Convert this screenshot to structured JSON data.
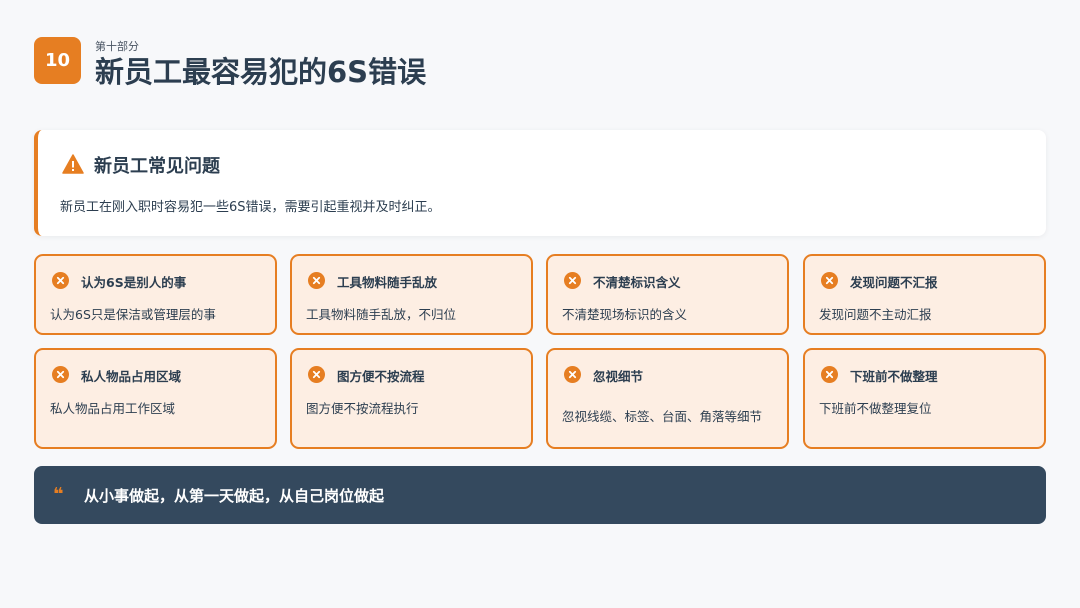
{
  "header": {
    "section_number": "10",
    "section_kicker": "第十部分",
    "title": "新员工最容易犯的6S错误"
  },
  "intro": {
    "icon": "warning-triangle-icon",
    "title": "新员工常见问题",
    "text": "新员工在刚入职时容易犯一些6S错误，需要引起重视并及时纠正。"
  },
  "mistakes": [
    {
      "title": "认为6S是别人的事",
      "desc": "认为6S只是保洁或管理层的事"
    },
    {
      "title": "工具物料随手乱放",
      "desc": "工具物料随手乱放，不归位"
    },
    {
      "title": "不清楚标识含义",
      "desc": "不清楚现场标识的含义"
    },
    {
      "title": "发现问题不汇报",
      "desc": "发现问题不主动汇报"
    },
    {
      "title": "私人物品占用区域",
      "desc": "私人物品占用工作区域"
    },
    {
      "title": "图方便不按流程",
      "desc": "图方便不按流程执行"
    },
    {
      "title": "忽视细节",
      "desc": "忽视线缆、标签、台面、角落等细节"
    },
    {
      "title": "下班前不做整理",
      "desc": "下班前不做整理复位"
    }
  ],
  "quote": {
    "icon": "quote-mark-icon",
    "text": "从小事做起，从第一天做起，从自己岗位做起"
  },
  "colors": {
    "accent": "#e67e22",
    "dark": "#34495e",
    "text": "#2c3e50",
    "card_fill": "#fdeee3"
  }
}
